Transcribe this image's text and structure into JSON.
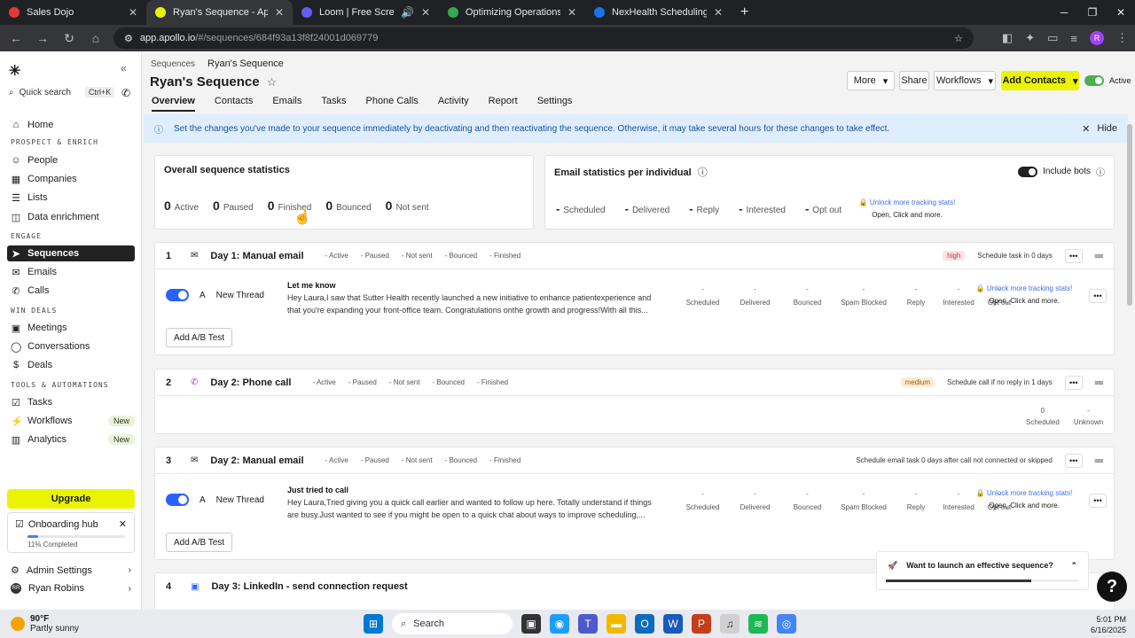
{
  "browser": {
    "tabs": [
      {
        "title": "Sales Dojo",
        "color": "#e53935"
      },
      {
        "title": "Ryan's Sequence - Apollo",
        "color": "#ebf400"
      },
      {
        "title": "Loom | Free Screen & Video",
        "color": "#625df5"
      },
      {
        "title": "Optimizing Operations: Virginia",
        "color": "#34a853"
      },
      {
        "title": "NexHealth Scheduling | Stream",
        "color": "#1a73e8"
      }
    ],
    "url_host": "app.apollo.io",
    "url_path": "/#/sequences/684f93a13f8f24001d069779"
  },
  "sidebar": {
    "quick_search": "Quick search",
    "shortcut": "Ctrl+K",
    "home": "Home",
    "sec_prospect": "PROSPECT & ENRICH",
    "people": "People",
    "companies": "Companies",
    "lists": "Lists",
    "data_enrichment": "Data enrichment",
    "sec_engage": "ENGAGE",
    "sequences": "Sequences",
    "emails": "Emails",
    "calls": "Calls",
    "sec_win": "WIN DEALS",
    "meetings": "Meetings",
    "conversations": "Conversations",
    "deals": "Deals",
    "sec_tools": "TOOLS & AUTOMATIONS",
    "tasks": "Tasks",
    "workflows": "Workflows",
    "analytics": "Analytics",
    "new_badge": "New",
    "upgrade": "Upgrade",
    "onboarding": "Onboarding hub",
    "onboarding_progress": "11% Completed",
    "onboarding_fraction": 0.11,
    "admin": "Admin Settings",
    "user": "Ryan Robins",
    "user_initials": "RR"
  },
  "header": {
    "breadcrumb_root": "Sequences",
    "breadcrumb_current": "Ryan's Sequence",
    "title": "Ryan's Sequence",
    "more": "More",
    "share": "Share",
    "workflows": "Workflows",
    "add_contacts": "Add Contacts",
    "status": "Active"
  },
  "tabs": [
    "Overview",
    "Contacts",
    "Emails",
    "Tasks",
    "Phone Calls",
    "Activity",
    "Report",
    "Settings"
  ],
  "banner": {
    "text": "Set the changes you've made to your sequence immediately by deactivating and then reactivating the sequence. Otherwise, it may take several hours for these changes to take effect.",
    "hide": "Hide"
  },
  "overall": {
    "title": "Overall sequence statistics",
    "stats": [
      {
        "value": "0",
        "label": "Active"
      },
      {
        "value": "0",
        "label": "Paused"
      },
      {
        "value": "0",
        "label": "Finished"
      },
      {
        "value": "0",
        "label": "Bounced"
      },
      {
        "value": "0",
        "label": "Not sent"
      }
    ]
  },
  "email_stats": {
    "title": "Email statistics per individual",
    "include_bots": "Include bots",
    "stats": [
      {
        "value": "-",
        "label": "Scheduled"
      },
      {
        "value": "-",
        "label": "Delivered"
      },
      {
        "value": "-",
        "label": "Reply"
      },
      {
        "value": "-",
        "label": "Interested"
      },
      {
        "value": "-",
        "label": "Opt out"
      }
    ],
    "unlock_title": "Unlock more tracking stats!",
    "unlock_sub": "Open, Click and more."
  },
  "step_labels": {
    "active": "Active",
    "paused": "Paused",
    "not_sent": "Not sent",
    "bounced": "Bounced",
    "finished": "Finished",
    "dash": "-"
  },
  "metric_labels": [
    "Scheduled",
    "Delivered",
    "Bounced",
    "Spam Blocked",
    "Reply",
    "Interested",
    "Opt out"
  ],
  "steps": [
    {
      "num": "1",
      "name": "Day 1: Manual email",
      "priority": "high",
      "schedule": "Schedule task in 0 days",
      "thread_letter": "A",
      "thread": "New Thread",
      "subject": "Let me know",
      "body1": "Hey Laura,I saw that Sutter Health recently launched a new initiative to enhance patientexperience and",
      "body2": "that you're expanding your front-office team. Congratulations onthe growth and progress!With all this...",
      "ab": "Add A/B Test"
    },
    {
      "num": "2",
      "name": "Day 2: Phone call",
      "priority": "medium",
      "schedule": "Schedule call if no reply in 1 days",
      "scheduled_value": "0",
      "scheduled_label": "Scheduled",
      "unknown_value": "-",
      "unknown_label": "Unknown"
    },
    {
      "num": "3",
      "name": "Day 2: Manual email",
      "schedule": "Schedule email task 0 days after call not connected or skipped",
      "thread_letter": "A",
      "thread": "New Thread",
      "subject": "Just tried to call",
      "body1": "Hey Laura,Tried giving you a quick call earlier and wanted to follow up here. Totally understand if things",
      "body2": "are busy.Just wanted to see if you might be open to a quick chat about ways to improve scheduling,...",
      "ab": "Add A/B Test"
    },
    {
      "num": "4",
      "name": "Day 3: LinkedIn - send connection request"
    }
  ],
  "help_widget": {
    "text": "Want to launch an effective sequence?",
    "progress_fraction": 0.75
  },
  "taskbar": {
    "temp": "90°F",
    "weather": "Partly sunny",
    "search": "Search",
    "time": "5:01 PM",
    "date": "6/16/2025"
  }
}
